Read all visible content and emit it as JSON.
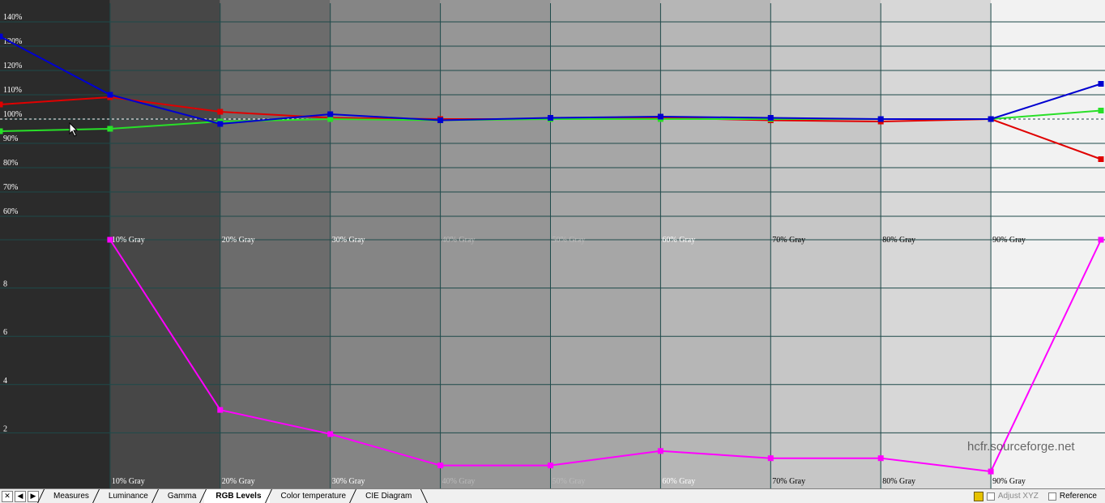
{
  "chart_data": [
    {
      "type": "line",
      "title": "",
      "xlabel": "",
      "ylabel": "",
      "x": [
        0,
        10,
        20,
        30,
        40,
        50,
        60,
        70,
        80,
        90,
        100
      ],
      "ylim": [
        50,
        150
      ],
      "yticks": [
        "140%",
        "130%",
        "120%",
        "110%",
        "100%",
        "90%",
        "80%",
        "70%",
        "60%"
      ],
      "ytick_values": [
        140,
        130,
        120,
        110,
        100,
        90,
        80,
        70,
        60
      ],
      "reference_line": 100,
      "series": [
        {
          "color": "#e00000",
          "values": [
            106,
            109,
            103,
            100.5,
            100,
            100,
            100.5,
            99.5,
            99,
            100,
            83.5
          ]
        },
        {
          "color": "#28e028",
          "values": [
            95,
            96,
            99,
            100,
            99.5,
            100,
            100,
            100,
            100,
            100,
            103.5
          ]
        },
        {
          "color": "#0000d0",
          "values": [
            134,
            110,
            98,
            102,
            99.5,
            100.5,
            101,
            100.5,
            100,
            100,
            114.5
          ]
        }
      ],
      "grid": true,
      "legend": "none"
    },
    {
      "type": "line",
      "title": "",
      "xlabel": "",
      "ylabel": "",
      "x": [
        10,
        20,
        30,
        40,
        50,
        60,
        70,
        80,
        90,
        100
      ],
      "ylim": [
        0,
        10
      ],
      "yticks": [
        "8",
        "6",
        "4",
        "2"
      ],
      "ytick_values": [
        8,
        6,
        4,
        2
      ],
      "series": [
        {
          "color": "#ff00ff",
          "values": [
            10,
            2.95,
            1.95,
            0.65,
            0.65,
            1.25,
            0.95,
            0.95,
            0.4,
            10
          ]
        }
      ],
      "grid": true,
      "legend": "none"
    }
  ],
  "category_labels": [
    "10% Gray",
    "20% Gray",
    "30% Gray",
    "40% Gray",
    "50% Gray",
    "60% Gray",
    "70% Gray",
    "80% Gray",
    "90% Gray"
  ],
  "tabs": {
    "nav": [
      "✕",
      "◀",
      "▶"
    ],
    "items": [
      "Measures",
      "Luminance",
      "Gamma",
      "RGB Levels",
      "Color temperature",
      "CIE Diagram"
    ],
    "active": "RGB Levels"
  },
  "tools": {
    "adjust_label": "Adjust XYZ",
    "reference_label": "Reference"
  },
  "watermark": "hcfr.sourceforge.net"
}
